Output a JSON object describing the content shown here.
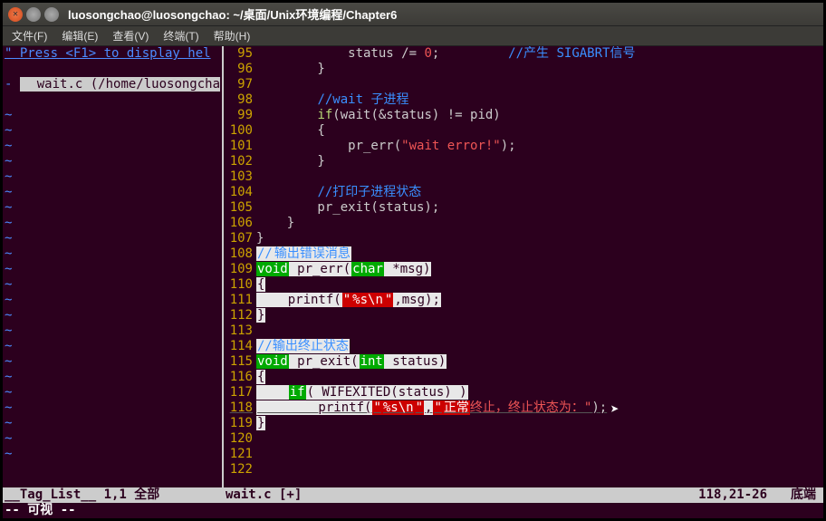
{
  "window": {
    "title": "luosongchao@luosongchao: ~/桌面/Unix环境编程/Chapter6"
  },
  "menu": {
    "file": "文件(F)",
    "edit": "编辑(E)",
    "view": "查看(V)",
    "terminal": "终端(T)",
    "help": "帮助(H)"
  },
  "left": {
    "hint": "\" Press <F1> to display hel",
    "file": "  wait.c (/home/luosongchao/>"
  },
  "lines": {
    "l95": {
      "no": "95",
      "code": "            status /= ",
      "num": "0",
      "tail": ";         ",
      "comment": "//产生 SIGABRT信号"
    },
    "l96": {
      "no": "96",
      "code": "        }"
    },
    "l97": {
      "no": "97",
      "code": ""
    },
    "l98": {
      "no": "98",
      "indent": "        ",
      "comment": "//wait 子进程"
    },
    "l99": {
      "no": "99",
      "code": "        ",
      "kw": "if",
      "after": "(wait(&status) != pid)"
    },
    "l100": {
      "no": "100",
      "code": "        {"
    },
    "l101": {
      "no": "101",
      "code": "            pr_err(",
      "str": "\"wait error!\"",
      "tail": ");"
    },
    "l102": {
      "no": "102",
      "code": "        }"
    },
    "l103": {
      "no": "103",
      "code": ""
    },
    "l104": {
      "no": "104",
      "indent": "        ",
      "comment": "//打印子进程状态"
    },
    "l105": {
      "no": "105",
      "code": "        pr_exit(status);"
    },
    "l106": {
      "no": "106",
      "code": "    }"
    },
    "l107": {
      "no": "107",
      "code": "}"
    },
    "l108": {
      "no": "108",
      "comment1": "//",
      "comment2": "输出错误消息"
    },
    "l109": {
      "no": "109",
      "kw": "void",
      "mid": " pr_err(",
      "type": "char",
      "tail": " *msg)"
    },
    "l110": {
      "no": "110",
      "code": "{"
    },
    "l111": {
      "no": "111",
      "pre": "    printf(",
      "strA": "\"",
      "fmt": "%s\\n",
      "strB": "\"",
      "tail": ",msg);"
    },
    "l112": {
      "no": "112",
      "code": "}"
    },
    "l113": {
      "no": "113",
      "code": ""
    },
    "l114": {
      "no": "114",
      "comment": "//输出终止状态"
    },
    "l115": {
      "no": "115",
      "kw": "void",
      "mid": " pr_exit(",
      "type": "int",
      "tail": " status)"
    },
    "l116": {
      "no": "116",
      "code": "{"
    },
    "l117": {
      "no": "117",
      "pre": "    ",
      "kw": "if",
      "tail": "( WIFEXITED(status) )"
    },
    "l118": {
      "no": "118",
      "pre": "        printf(",
      "strA": "\"",
      "fmt": "%s\\n",
      "strB": "\"",
      "comma": ",",
      "msgA": "\"",
      "msgB": "正常",
      "msgC": "终止，终止状态为：\"",
      "tail": ");"
    },
    "l119": {
      "no": "119",
      "code": "}"
    },
    "l120": {
      "no": "120",
      "code": ""
    },
    "l121": {
      "no": "121",
      "code": ""
    },
    "l122": {
      "no": "122",
      "code": ""
    }
  },
  "status": {
    "left": "__Tag_List__   1,1         全部",
    "file": "wait.c [+]",
    "pos": "118,21-26",
    "loc": "底端"
  },
  "mode": "-- 可视 --"
}
